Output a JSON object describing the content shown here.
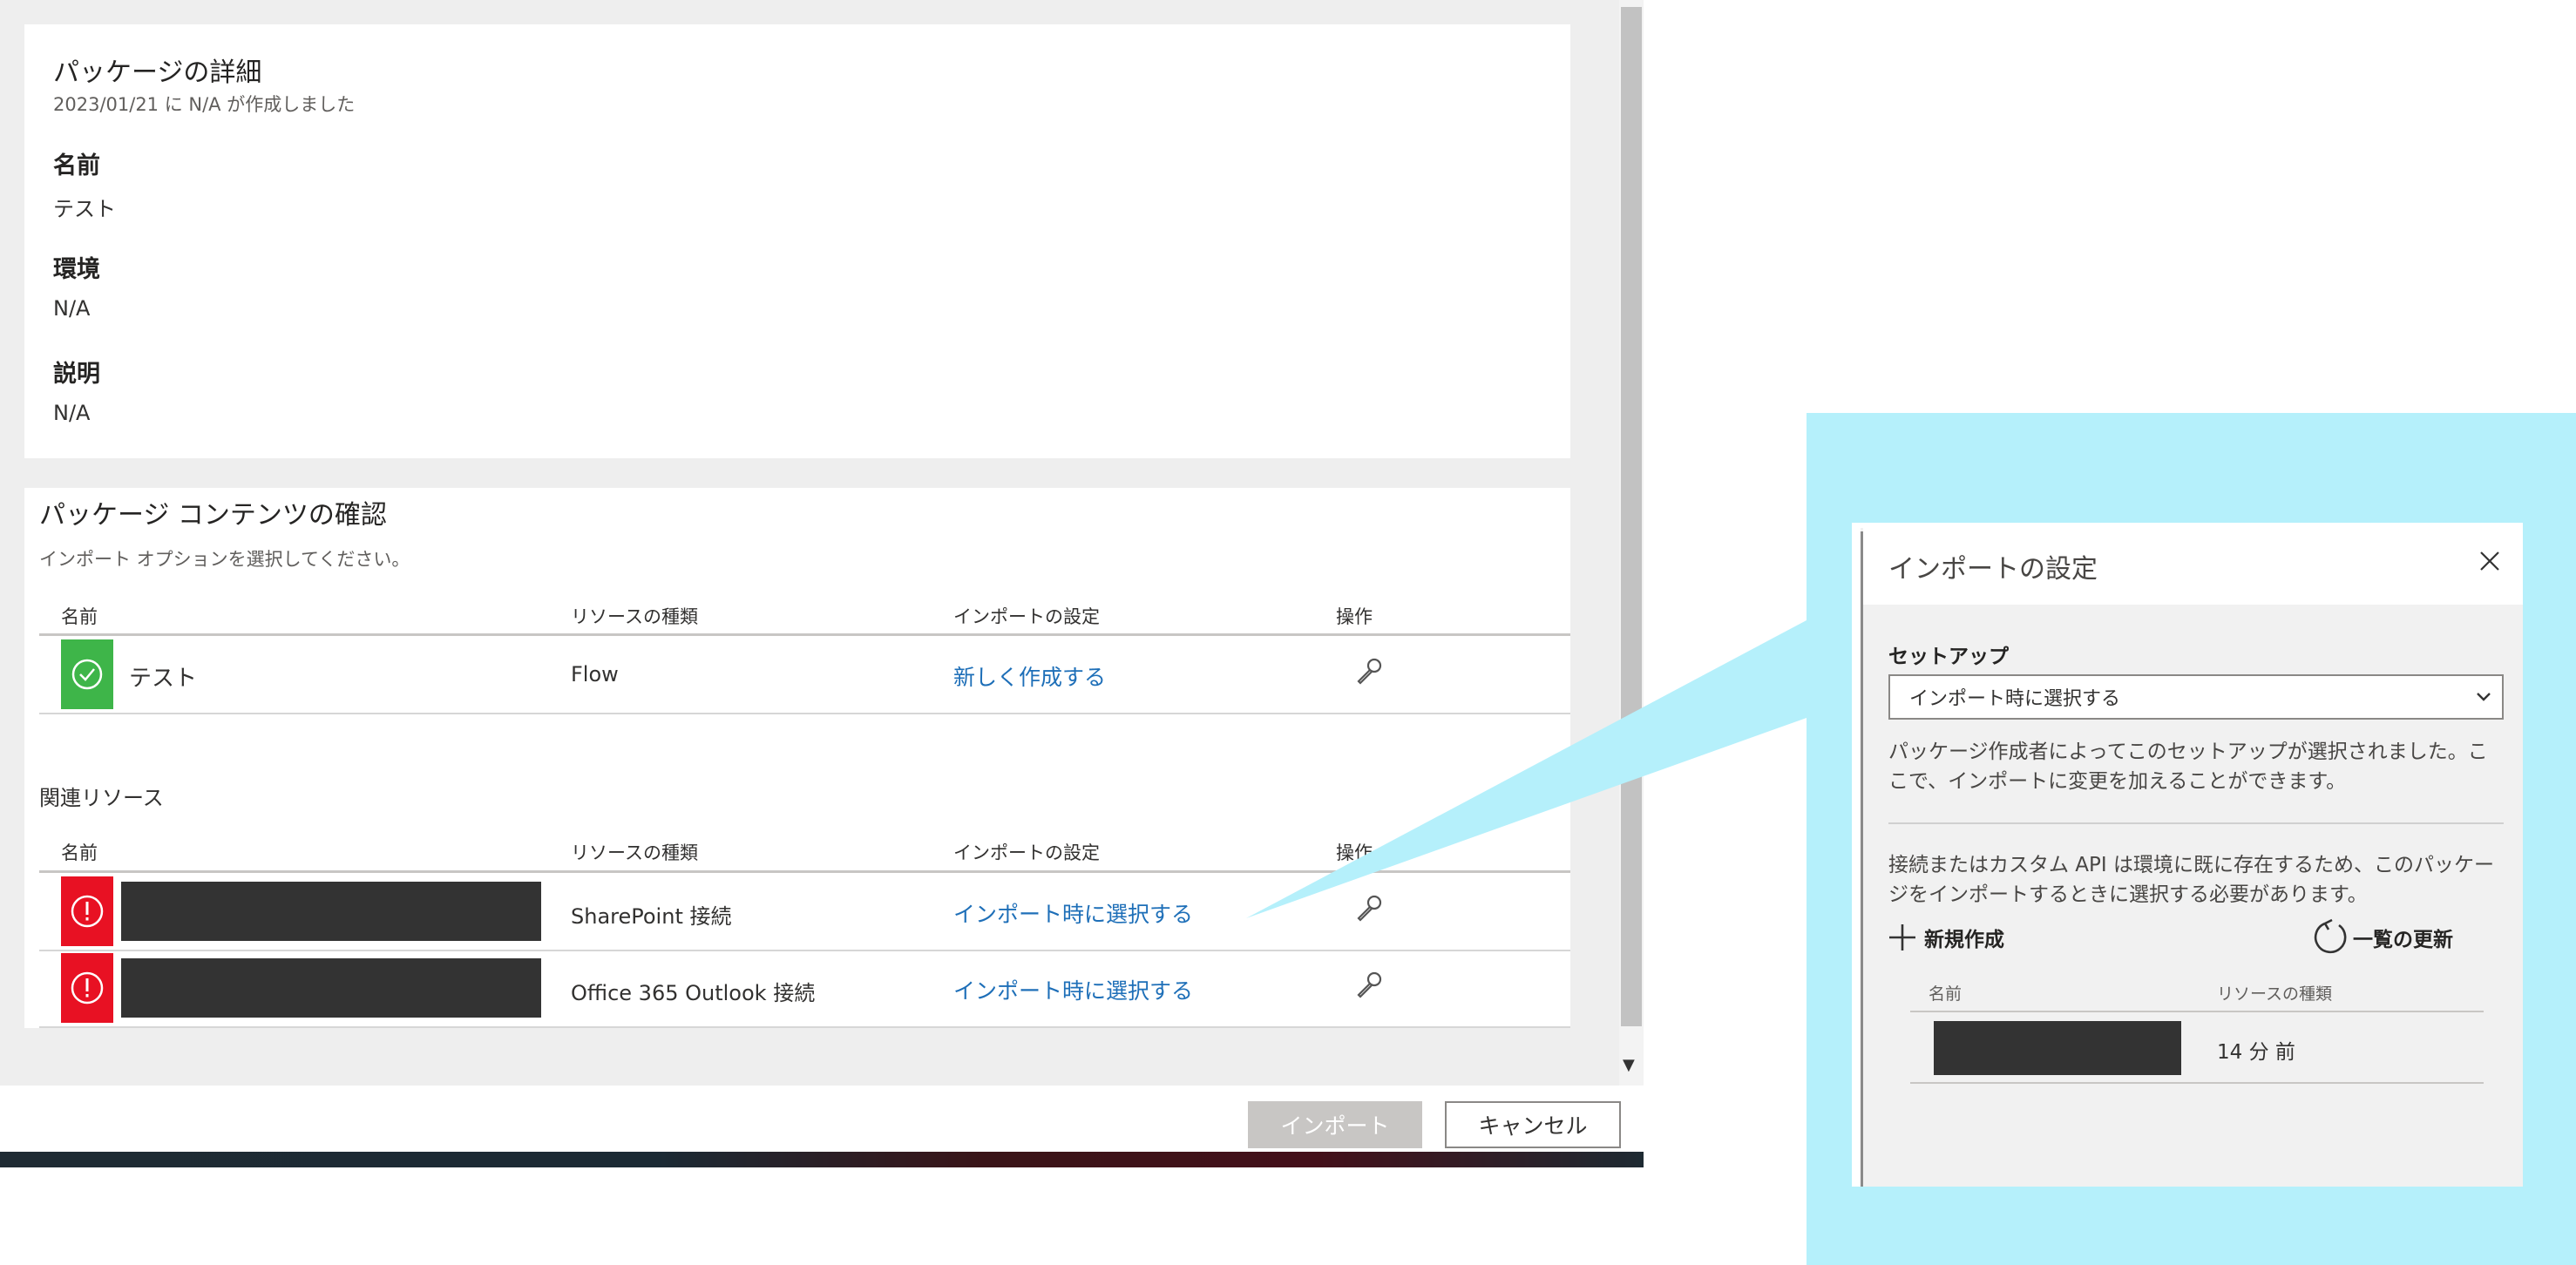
{
  "details": {
    "title": "パッケージの詳細",
    "created": "2023/01/21 に N/A が作成しました",
    "name_label": "名前",
    "name_value": "テスト",
    "env_label": "環境",
    "env_value": "N/A",
    "desc_label": "説明",
    "desc_value": "N/A"
  },
  "contents": {
    "title": "パッケージ コンテンツの確認",
    "subtitle": "インポート オプションを選択してください。",
    "columns": [
      "名前",
      "リソースの種類",
      "インポートの設定",
      "操作"
    ],
    "rows": [
      {
        "name": "テスト",
        "type": "Flow",
        "setting": "新しく作成する",
        "status": "ok"
      }
    ],
    "related_title": "関連リソース",
    "related_columns": [
      "名前",
      "リソースの種類",
      "インポートの設定",
      "操作"
    ],
    "related_rows": [
      {
        "type": "SharePoint 接続",
        "setting": "インポート時に選択する",
        "status": "error"
      },
      {
        "type": "Office 365 Outlook 接続",
        "setting": "インポート時に選択する",
        "status": "error"
      }
    ]
  },
  "footer": {
    "import_label": "インポート",
    "cancel_label": "キャンセル"
  },
  "panel": {
    "title": "インポートの設定",
    "setup_label": "セットアップ",
    "setup_value": "インポート時に選択する",
    "setup_desc": "パッケージ作成者によってこのセットアップが選択されました。ここで、インポートに変更を加えることができます。",
    "conn_desc": "接続またはカスタム API は環境に既に存在するため、このパッケージをインポートするときに選択する必要があります。",
    "new_label": "新規作成",
    "refresh_label": "一覧の更新",
    "columns": [
      "名前",
      "リソースの種類"
    ],
    "row_time": "14 分 前"
  },
  "colors": {
    "accent_link": "#1e6fb8",
    "ok": "#3eb549",
    "error": "#e81123",
    "highlight": "#b5f0fb"
  }
}
